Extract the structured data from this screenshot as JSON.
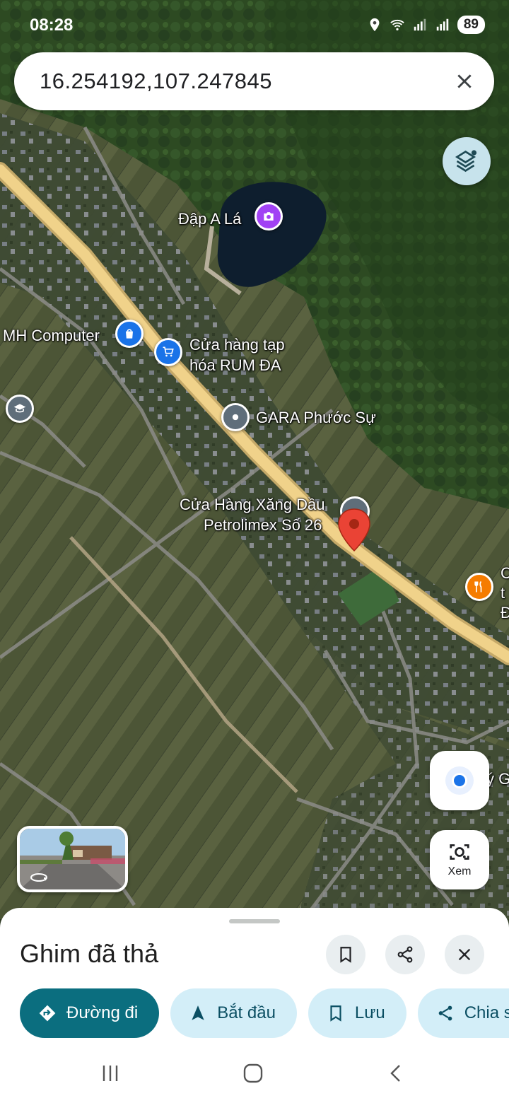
{
  "status_bar": {
    "time": "08:28",
    "battery": "89"
  },
  "search": {
    "query": "16.254192,107.247845"
  },
  "map": {
    "labels": {
      "dap_a_la": "Đập A Lá",
      "mh_computer": "MH Computer",
      "rum_da_line1": "Cửa hàng tạp",
      "rum_da_line2": "hóa RUM ĐA",
      "gara": "GARA Phước Sự",
      "petrolimex_line1": "Cửa Hàng Xăng Dầu",
      "petrolimex_line2": "Petrolimex Số 26",
      "edge_c": "C",
      "edge_t": "t",
      "edge_d": "Đ",
      "edge_yg": "ý G"
    },
    "pin_color": "#ea4335"
  },
  "controls": {
    "lens_label": "Xem"
  },
  "sheet": {
    "title": "Ghim đã thả",
    "chips": {
      "directions": "Đường đi",
      "start": "Bắt đầu",
      "save": "Lưu",
      "share": "Chia s"
    }
  },
  "colors": {
    "accent": "#0b6e7f",
    "chip_bg": "#d3eef8",
    "road": "#f0d28a"
  }
}
